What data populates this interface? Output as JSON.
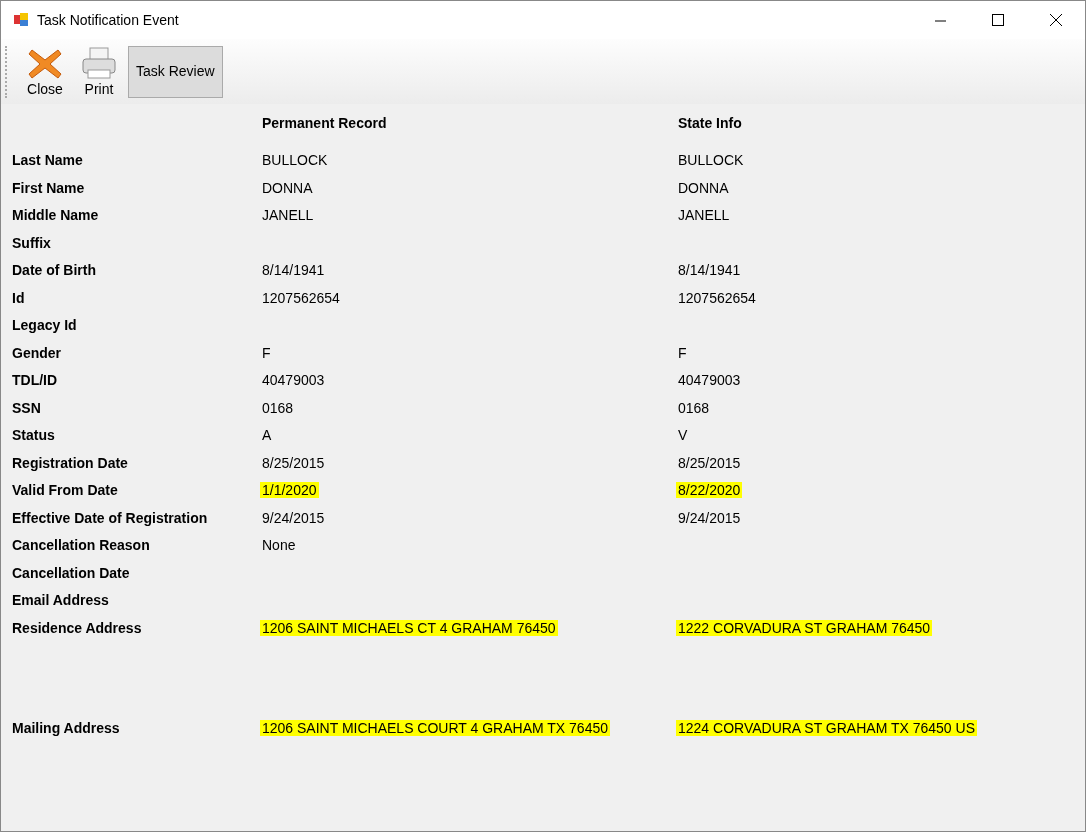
{
  "window": {
    "title": "Task Notification Event"
  },
  "toolbar": [
    {
      "kind": "close",
      "label": "Close"
    },
    {
      "kind": "print",
      "label": "Print"
    },
    {
      "kind": "text",
      "label": "Task Review",
      "selected": true
    }
  ],
  "columns": [
    "Permanent Record",
    "State Info"
  ],
  "rows": [
    {
      "kind": "field",
      "label": "Last Name",
      "permanent": {
        "value": "BULLOCK",
        "highlighted": false
      },
      "state": {
        "value": "BULLOCK",
        "highlighted": false
      }
    },
    {
      "kind": "field",
      "label": "First Name",
      "permanent": {
        "value": "DONNA",
        "highlighted": false
      },
      "state": {
        "value": "DONNA",
        "highlighted": false
      }
    },
    {
      "kind": "field",
      "label": "Middle Name",
      "permanent": {
        "value": "JANELL",
        "highlighted": false
      },
      "state": {
        "value": "JANELL",
        "highlighted": false
      }
    },
    {
      "kind": "field",
      "label": "Suffix"
    },
    {
      "kind": "field",
      "label": "Date of Birth",
      "permanent": {
        "value": "8/14/1941",
        "highlighted": false
      },
      "state": {
        "value": "8/14/1941",
        "highlighted": false
      }
    },
    {
      "kind": "field",
      "label": "Id",
      "permanent": {
        "value": "1207562654",
        "highlighted": false
      },
      "state": {
        "value": "1207562654",
        "highlighted": false
      }
    },
    {
      "kind": "field",
      "label": "Legacy Id"
    },
    {
      "kind": "field",
      "label": "Gender",
      "permanent": {
        "value": "F",
        "highlighted": false
      },
      "state": {
        "value": "F",
        "highlighted": false
      }
    },
    {
      "kind": "field",
      "label": "TDL/ID",
      "permanent": {
        "value": "40479003",
        "highlighted": false
      },
      "state": {
        "value": "40479003",
        "highlighted": false
      }
    },
    {
      "kind": "field",
      "label": "SSN",
      "permanent": {
        "value": "0168",
        "highlighted": false
      },
      "state": {
        "value": "0168",
        "highlighted": false
      }
    },
    {
      "kind": "field",
      "label": "Status",
      "permanent": {
        "value": "A",
        "highlighted": false
      },
      "state": {
        "value": "V",
        "highlighted": false
      }
    },
    {
      "kind": "field",
      "label": "Registration Date",
      "permanent": {
        "value": "8/25/2015",
        "highlighted": false
      },
      "state": {
        "value": "8/25/2015",
        "highlighted": false
      }
    },
    {
      "kind": "field",
      "label": "Valid From Date",
      "permanent": {
        "value": "1/1/2020",
        "highlighted": true
      },
      "state": {
        "value": "8/22/2020",
        "highlighted": true
      }
    },
    {
      "kind": "field",
      "label": "Effective Date of Registration",
      "permanent": {
        "value": "9/24/2015",
        "highlighted": false
      },
      "state": {
        "value": "9/24/2015",
        "highlighted": false
      }
    },
    {
      "kind": "field",
      "label": "Cancellation Reason",
      "permanent": {
        "value": "None",
        "highlighted": false
      }
    },
    {
      "kind": "field",
      "label": "Cancellation Date"
    },
    {
      "kind": "field",
      "label": "Email Address"
    },
    {
      "kind": "address",
      "label": "Residence Address",
      "permanent": {
        "value": "1206 SAINT MICHAELS CT 4 GRAHAM 76450",
        "highlighted": true
      },
      "state": {
        "value": "1222 CORVADURA ST GRAHAM 76450",
        "highlighted": true
      }
    },
    {
      "kind": "field",
      "label": "Mailing Address",
      "permanent": {
        "value": "1206 SAINT MICHAELS COURT 4 GRAHAM TX 76450",
        "highlighted": true
      },
      "state": {
        "value": "1224 CORVADURA ST GRAHAM TX 76450 US",
        "highlighted": true
      }
    }
  ]
}
